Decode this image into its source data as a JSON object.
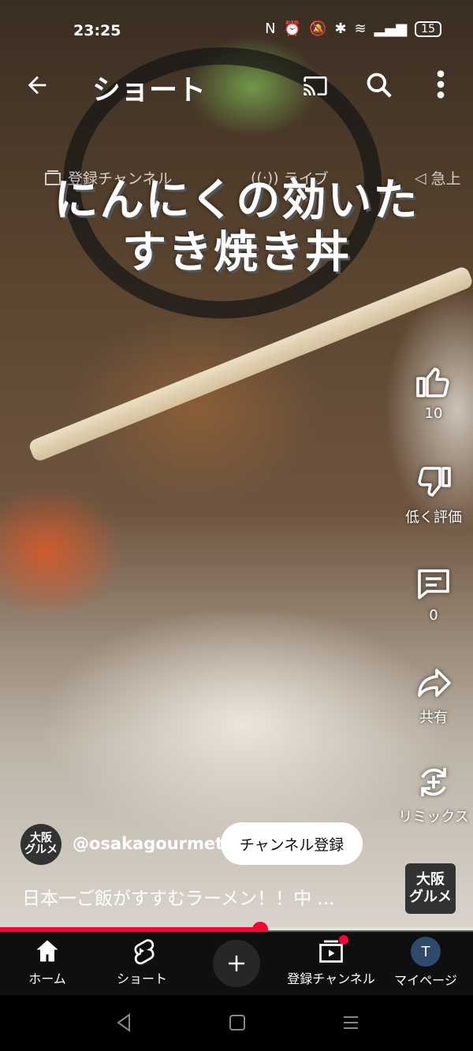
{
  "status_bar": {
    "time": "23:25",
    "battery": "15"
  },
  "header": {
    "title": "ショート"
  },
  "tabs": [
    "登録チャンネル",
    "ライブ",
    "急上"
  ],
  "overlay_text": [
    "にんにくの効いた",
    "すき焼き丼"
  ],
  "actions": {
    "like_count": "10",
    "dislike_label": "低く評価",
    "comment_count": "0",
    "share_label": "共有",
    "remix_label": "リミックス"
  },
  "channel": {
    "avatar_text": "大阪\nグルメ",
    "handle": "@osakagourmet",
    "subscribe_label": "チャンネル登録"
  },
  "description": "日本一ご飯がすすむラーメン！！中 ...",
  "watermark": "大阪\nグルメ",
  "progress": 0.55,
  "bottom_nav": {
    "home": "ホーム",
    "shorts": "ショート",
    "subscriptions": "登録チャンネル",
    "profile": "マイページ",
    "profile_initial": "T"
  },
  "colors": {
    "accent": "#ff0033",
    "nav_bg": "#0f0f0f"
  }
}
